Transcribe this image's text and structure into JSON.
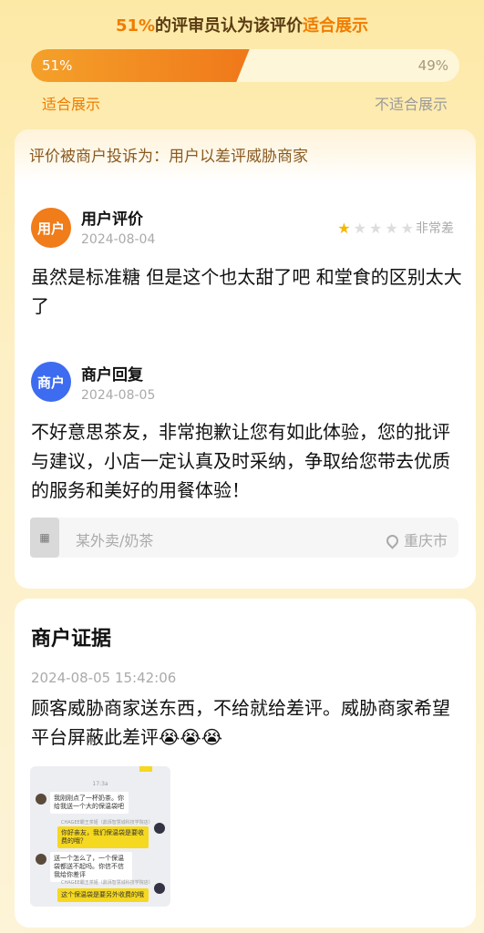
{
  "header": {
    "title_pct": "51%",
    "title_mid": "的评审员认为该评价",
    "title_end": "适合展示"
  },
  "vote": {
    "suitable_pct_label": "51%",
    "unsuitable_pct_label": "49%",
    "suitable_fraction": 0.51,
    "suitable_label": "适合展示",
    "unsuitable_label": "不适合展示"
  },
  "complaint": "评价被商户投诉为：用户以差评威胁商家",
  "user_review": {
    "avatar_text": "用户",
    "author": "用户评价",
    "date": "2024-08-04",
    "rating": 1,
    "rating_max": 5,
    "rating_label": "非常差",
    "text": "虽然是标准糖 但是这个也太甜了吧 和堂食的区别太大了"
  },
  "merchant_reply": {
    "avatar_text": "商户",
    "author": "商户回复",
    "date": "2024-08-05",
    "text": "不好意思茶友，非常抱歉让您有如此体验，您的批评与建议，小店一定认真及时采纳，争取给您带去优质的服务和美好的用餐体验！"
  },
  "store": {
    "name": "某外卖/奶茶",
    "city": "重庆市"
  },
  "evidence": {
    "title": "商户证据",
    "datetime": "2024-08-05 15:42:06",
    "text": "顾客威胁商家送东西，不给就给差评。威胁商家希望平台屏蔽此差评😭😭😭",
    "chat": {
      "time": "17:3a",
      "msg1": "我刚刚点了一杯奶茶。你给我送一个大的保温袋吧",
      "meta1": "CHAGEE霸王茶姬（鼎湃智慧城科技学院店）",
      "msg2": "你好亲友，我们保温袋是要收费的哦？",
      "msg3": "送一个怎么了，一个保温袋都送不起吗。你信不信我给你差评",
      "meta2": "CHAGEE霸王茶姬（鼎湃智慧城科技学院店）",
      "msg4": "这个保温袋是要另外收费的哦"
    }
  }
}
